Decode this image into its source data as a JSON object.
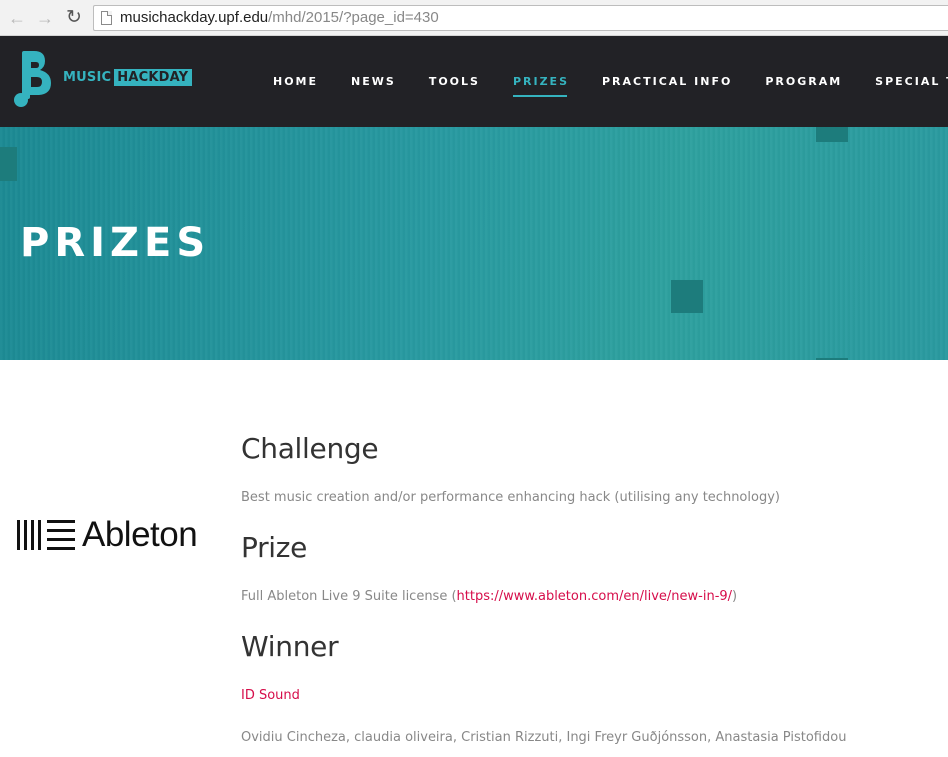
{
  "browser": {
    "url_domain": "musichackday.upf.edu",
    "url_path": "/mhd/2015/?page_id=430"
  },
  "site": {
    "logo_music": "MUSIC",
    "logo_hackday": "HACKDAY",
    "brand_color": "#35b3bf",
    "nav": [
      {
        "label": "HOME"
      },
      {
        "label": "NEWS"
      },
      {
        "label": "TOOLS"
      },
      {
        "label": "PRIZES",
        "active": true
      },
      {
        "label": "PRACTICAL INFO"
      },
      {
        "label": "PROGRAM"
      },
      {
        "label": "SPECIAL TRACK"
      }
    ]
  },
  "hero": {
    "title": "PRIZES"
  },
  "sponsor": {
    "name": "Ableton"
  },
  "content": {
    "challenge_heading": "Challenge",
    "challenge_text": "Best music creation and/or performance enhancing hack (utilising any technology)",
    "prize_heading": "Prize",
    "prize_text_before": "Full Ableton Live 9 Suite license (",
    "prize_link": "https://www.ableton.com/en/live/new-in-9/",
    "prize_text_after": ")",
    "winner_heading": "Winner",
    "winner_link": "ID Sound",
    "winner_team": "Ovidiu Cincheza, claudia oliveira, Cristian Rizzuti, Ingi Freyr Guðjónsson, Anastasia Pistofidou"
  }
}
